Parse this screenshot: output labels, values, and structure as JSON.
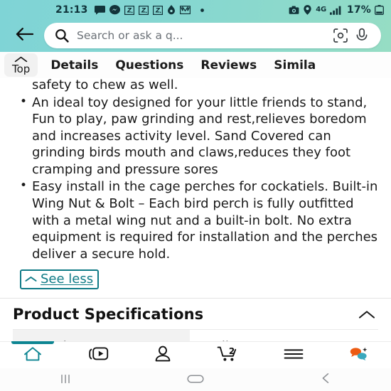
{
  "statusbar": {
    "clock": "21:13",
    "battery_percent": "17%",
    "network": "4G",
    "left_icons": [
      "message-icon",
      "messenger-icon",
      "dnd-badge-icon",
      "dnd-badge-icon",
      "dnd-badge-icon",
      "savings-icon",
      "gmail-icon",
      "dot-icon"
    ],
    "right_icons": [
      "camera-blocked-icon",
      "location-icon",
      "network-4g-icon",
      "signal-bars-icon",
      "battery-icon"
    ]
  },
  "header": {
    "back_icon": "arrow-left-icon",
    "search": {
      "placeholder": "Search or ask a q...",
      "value": "",
      "search_icon": "search-icon",
      "lens_icon": "camera-lens-icon",
      "mic_icon": "microphone-icon"
    },
    "bg_color": "#7fd4d6"
  },
  "tabs": {
    "items": [
      {
        "label": "Top",
        "icon": "chevron-up-icon",
        "active": true
      },
      {
        "label": "Details",
        "active": false
      },
      {
        "label": "Questions",
        "active": false
      },
      {
        "label": "Reviews",
        "active": false
      },
      {
        "label": "Simila",
        "active": false
      }
    ]
  },
  "description": {
    "first_line_continuation": "safety to chew as well.",
    "bullets": [
      "An ideal toy designed for your little friends to stand, Fun to play, paw grinding and rest,relieves boredom and increases activity level. Sand Covered can grinding birds mouth and claws,reduces they foot cramping and pressure sores",
      "Easy install in the cage perches for cockatiels. Built-in Wing Nut & Bolt – Each bird perch is fully outfitted with a metal wing nut and a built-in bolt. No extra equipment is required for installation and the perches deliver a secure hold."
    ],
    "see_less_label": "See less",
    "see_less_icon": "chevron-up-icon",
    "link_color": "#0f7a86"
  },
  "specifications": {
    "title": "Product Specifications",
    "collapse_icon": "chevron-up-icon",
    "rows": [
      {
        "key": "Brand",
        "value": "Mrli Pet"
      }
    ]
  },
  "bottomnav": {
    "items": [
      {
        "name": "home",
        "icon": "home-icon",
        "active": true
      },
      {
        "name": "videos",
        "icon": "video-play-icon",
        "active": false
      },
      {
        "name": "account",
        "icon": "person-icon",
        "active": false
      },
      {
        "name": "cart",
        "icon": "shopping-cart-icon",
        "badge": "2",
        "active": false
      },
      {
        "name": "menu",
        "icon": "hamburger-menu-icon",
        "active": false
      },
      {
        "name": "assistant",
        "icon": "chat-bubbles-sparkle-icon",
        "active": false
      }
    ],
    "active_color": "#0d8592"
  },
  "sysnav": {
    "items": [
      {
        "name": "recents",
        "icon": "recents-bars-icon"
      },
      {
        "name": "home",
        "icon": "home-pill-icon"
      },
      {
        "name": "back",
        "icon": "chevron-left-icon"
      }
    ]
  }
}
